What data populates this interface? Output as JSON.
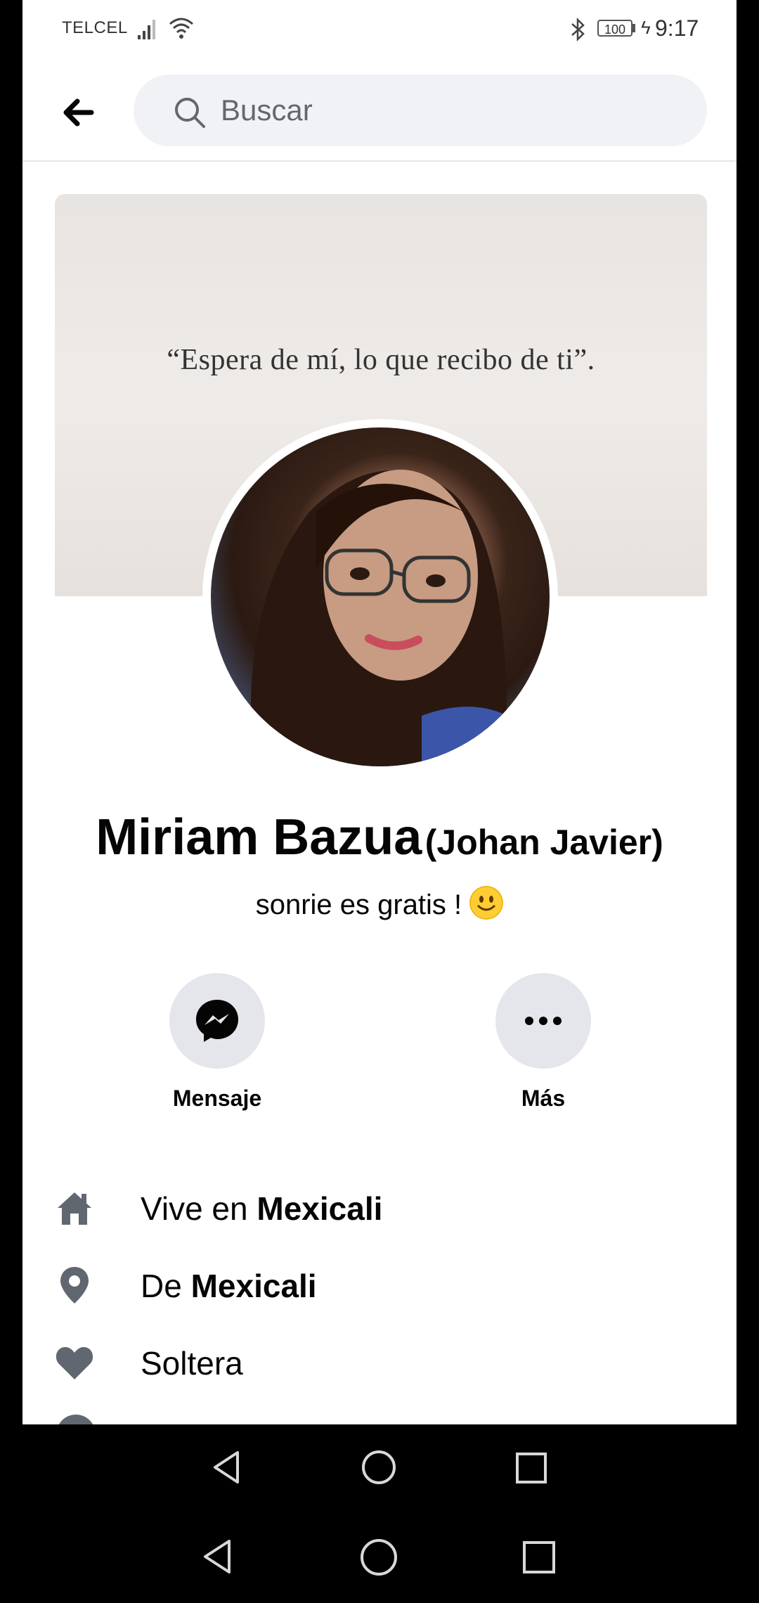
{
  "status_bar": {
    "carrier": "TELCEL",
    "battery": "100",
    "time": "9:17"
  },
  "header": {
    "search_placeholder": "Buscar"
  },
  "cover": {
    "quote": "“Espera de mí, lo que recibo de ti”."
  },
  "profile": {
    "name": "Miriam Bazua",
    "alternate_name": "(Johan Javier)",
    "bio": "sonrie es gratis ! "
  },
  "actions": {
    "message_label": "Mensaje",
    "more_label": "Más"
  },
  "info": [
    {
      "icon": "home-icon",
      "prefix": "Vive en ",
      "value": "Mexicali"
    },
    {
      "icon": "location-pin-icon",
      "prefix": "De ",
      "value": "Mexicali"
    },
    {
      "icon": "heart-icon",
      "prefix": "",
      "value": "Soltera"
    }
  ],
  "colors": {
    "search_bg": "#f0f2f5",
    "action_bg": "#e4e6eb",
    "text": "#050505",
    "secondary_text": "#65676b"
  }
}
